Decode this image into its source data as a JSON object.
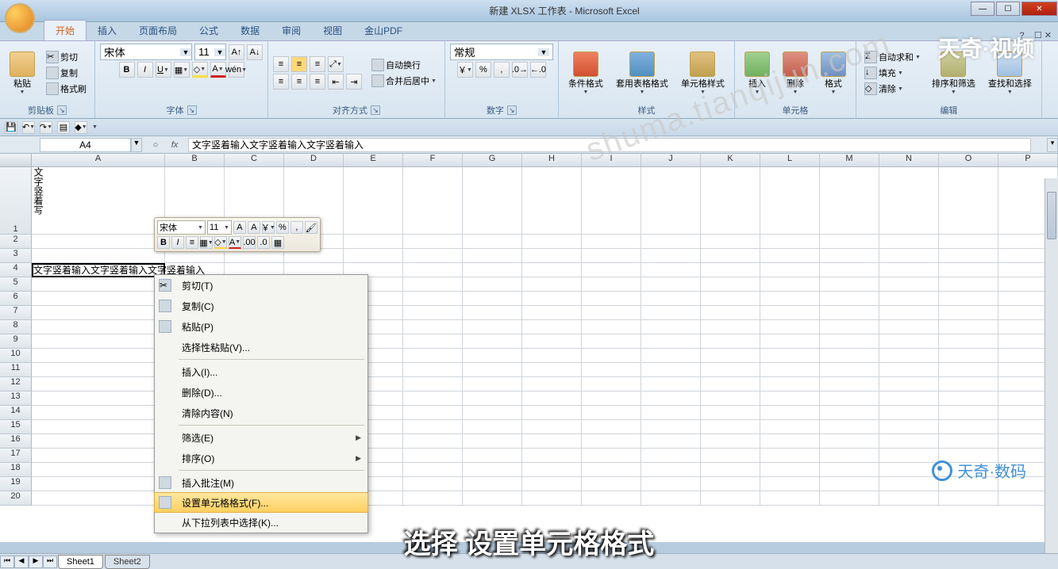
{
  "title": "新建 XLSX 工作表 - Microsoft Excel",
  "watermark_top": "天奇·视频",
  "watermark_url": "shuma.tianqijun.com",
  "watermark_br": "天奇·数码",
  "subtitle": "选择 设置单元格格式",
  "tabs": {
    "home": "开始",
    "insert": "插入",
    "layout": "页面布局",
    "formula": "公式",
    "data": "数据",
    "review": "审阅",
    "view": "视图",
    "wps": "金山PDF"
  },
  "ribbon": {
    "clipboard": {
      "label": "剪贴板",
      "paste": "粘贴",
      "cut": "剪切",
      "copy": "复制",
      "brush": "格式刷"
    },
    "font": {
      "label": "字体",
      "name": "宋体",
      "size": "11"
    },
    "align": {
      "label": "对齐方式",
      "wrap": "自动换行",
      "merge": "合并后居中"
    },
    "number": {
      "label": "数字",
      "format": "常规"
    },
    "styles": {
      "label": "样式",
      "cond": "条件格式",
      "table": "套用表格格式",
      "cell": "单元格样式"
    },
    "cells": {
      "label": "单元格",
      "insert": "插入",
      "delete": "删除",
      "format": "格式"
    },
    "edit": {
      "label": "编辑",
      "sum": "自动求和",
      "fill": "填充",
      "clear": "清除",
      "sort": "排序和筛选",
      "find": "查找和选择"
    }
  },
  "namebox": "A4",
  "formula": "文字竖着输入文字竖着输入文字竖着输入",
  "cells": {
    "a1": "文字竖着写",
    "a4": "文字竖着输入文字竖着输入文字竖着输入"
  },
  "mini": {
    "font": "宋体",
    "size": "11"
  },
  "ctx": {
    "cut": "剪切(T)",
    "copy": "复制(C)",
    "paste": "粘贴(P)",
    "pspecial": "选择性粘贴(V)...",
    "insert": "插入(I)...",
    "delete": "删除(D)...",
    "clear": "清除内容(N)",
    "filter": "筛选(E)",
    "sort": "排序(O)",
    "comment": "插入批注(M)",
    "format": "设置单元格格式(F)...",
    "picklist": "从下拉列表中选择(K)..."
  },
  "sheets": {
    "s1": "Sheet1",
    "s2": "Sheet2"
  },
  "cols": [
    "A",
    "B",
    "C",
    "D",
    "E",
    "F",
    "G",
    "H",
    "I",
    "J",
    "K",
    "L",
    "M",
    "N",
    "O",
    "P"
  ]
}
